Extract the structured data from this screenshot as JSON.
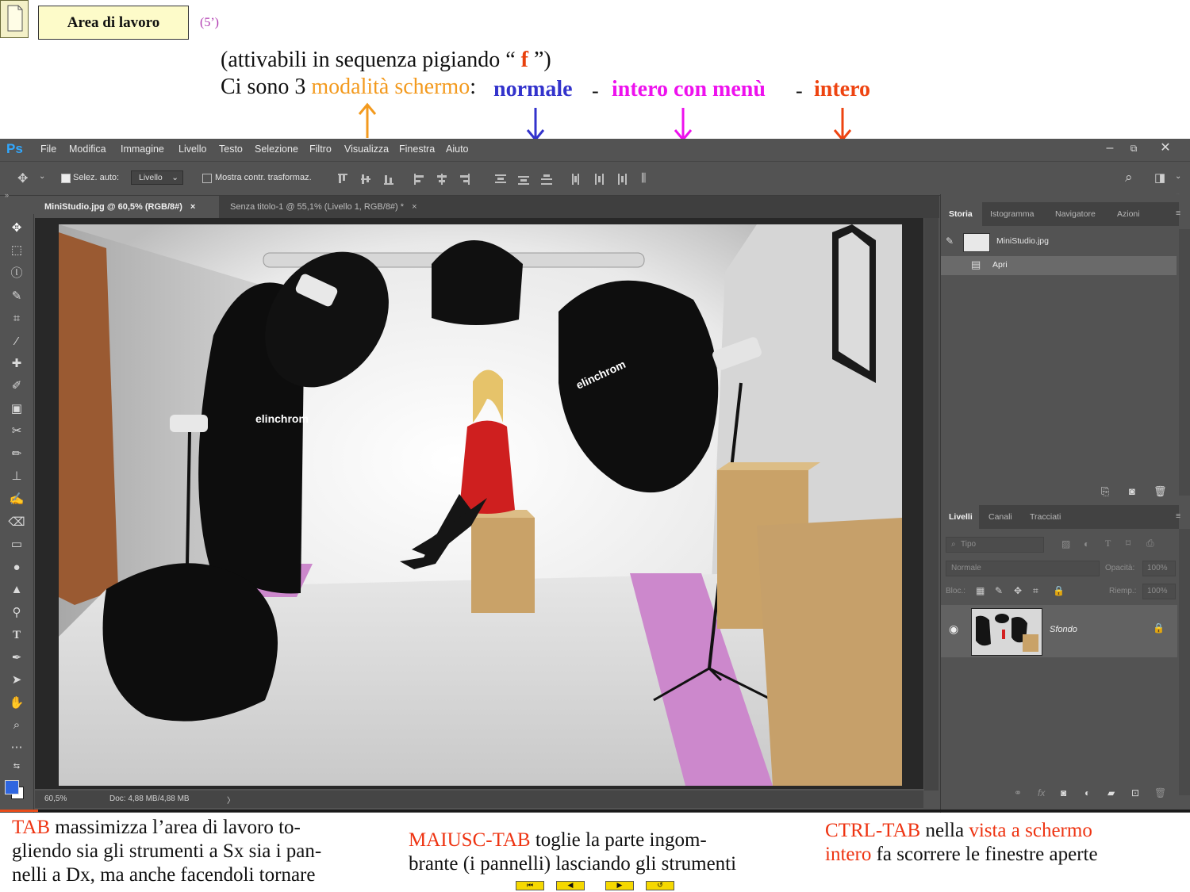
{
  "slide": {
    "title": "Area di lavoro",
    "duration": "(5’)",
    "intro_before": "(attivabili in sequenza pigiando “ ",
    "intro_key": "f",
    "intro_after": " ”)",
    "modes_prefix": "Ci sono 3 ",
    "modes_highlight": "modalità schermo",
    "modes_colon": ":",
    "mode_normal": "normale",
    "dash": "-",
    "mode_full_menu": "intero con menù",
    "mode_full": "intero",
    "colors": {
      "orange": "#f39a1e",
      "blue": "#3333cc",
      "magenta": "#ee11ee",
      "red": "#ee4411"
    }
  },
  "photoshop": {
    "logo": "Ps",
    "menu": [
      "File",
      "Modifica",
      "Immagine",
      "Livello",
      "Testo",
      "Selezione",
      "Filtro",
      "Visualizza",
      "Finestra",
      "Aiuto"
    ],
    "options": {
      "auto_select_label": "Selez. auto:",
      "auto_select_value": "Livello",
      "transform_label": "Mostra contr. trasformaz."
    },
    "tabs": [
      {
        "label": "MiniStudio.jpg @ 60,5% (RGB/8#)",
        "close": "×"
      },
      {
        "label": "Senza titolo-1 @ 55,1% (Livello 1, RGB/8#) *",
        "close": "×"
      }
    ],
    "status": {
      "zoom": "60,5%",
      "doc": "Doc: 4,88 MB/4,88 MB",
      "arrow": "〉"
    },
    "history_panel": {
      "tabs": [
        "Storia",
        "Istogramma",
        "Navigatore",
        "Azioni"
      ],
      "items": [
        "MiniStudio.jpg",
        "Apri"
      ]
    },
    "layers_panel": {
      "tabs": [
        "Livelli",
        "Canali",
        "Tracciati"
      ],
      "filter_placeholder": "Tipo",
      "blend_mode": "Normale",
      "opacity_label": "Opacità:",
      "opacity_value": "100%",
      "lock_label": "Bloc.:",
      "fill_label": "Riemp.:",
      "fill_value": "100%",
      "layer_name": "Sfondo"
    }
  },
  "notes": {
    "tab_key": "TAB",
    "tab_line1": " massimizza l’area di lavoro to-",
    "tab_line2": "gliendo sia gli strumenti a Sx sia i pan-",
    "tab_line3": "nelli a Dx, ma anche facendoli tornare",
    "shift_key": "MAIUSC-TAB",
    "shift_line1": " toglie la parte ingom-",
    "shift_line2": "brante (i pannelli) lasciando gli strumenti",
    "ctrl_key": "CTRL-TAB",
    "ctrl_line1_mid": " nella ",
    "ctrl_line1_hl": "vista a schermo",
    "ctrl_line2_hl": "intero",
    "ctrl_line2_rest": " fa scorrere le finestre aperte"
  }
}
